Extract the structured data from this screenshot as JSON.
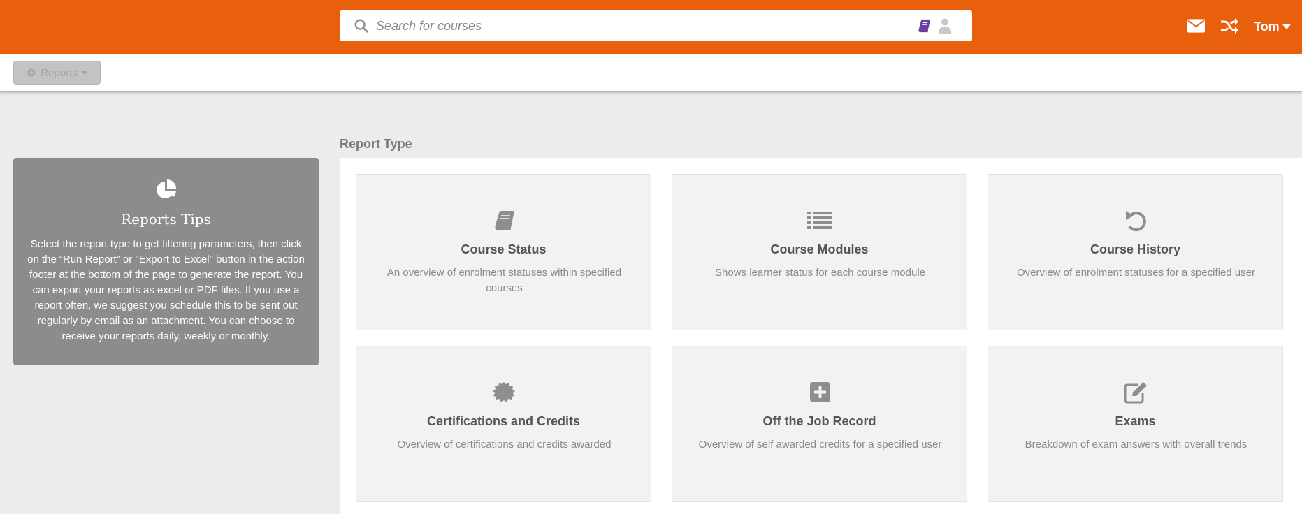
{
  "header": {
    "search_placeholder": "Search for courses",
    "user_name": "Tom",
    "icons": [
      "search-icon",
      "book-icon",
      "person-icon",
      "mail-icon",
      "shuffle-icon"
    ]
  },
  "toolbar": {
    "reports_label": "Reports"
  },
  "tips": {
    "title": "Reports Tips",
    "body": "Select the report type to get filtering parameters, then click on the “Run Report” or \"Export to Excel\" button in the action footer at the bottom of the page to generate the report. You can export your reports as excel or PDF files. If you use a report often, we suggest you schedule this to be sent out regularly by email as an attachment. You can choose to receive your reports daily, weekly or monthly."
  },
  "report_type": {
    "label": "Report Type",
    "cards": [
      {
        "title": "Course Status",
        "desc": "An overview of enrolment statuses within specified courses",
        "icon": "book-icon"
      },
      {
        "title": "Course Modules",
        "desc": "Shows learner status for each course module",
        "icon": "list-icon"
      },
      {
        "title": "Course History",
        "desc": "Overview of enrolment statuses for a specified user",
        "icon": "history-icon"
      },
      {
        "title": "Certifications and Credits",
        "desc": "Overview of certifications and credits awarded",
        "icon": "certificate-icon"
      },
      {
        "title": "Off the Job Record",
        "desc": "Overview of self awarded credits for a specified user",
        "icon": "plus-square-icon"
      },
      {
        "title": "Exams",
        "desc": "Breakdown of exam answers with overall trends",
        "icon": "edit-icon"
      }
    ]
  },
  "colors": {
    "brand": "#e8600c",
    "book_accent": "#6c3fa0",
    "tips_bg": "#8c8c8c",
    "card_bg": "#f2f2f2"
  }
}
